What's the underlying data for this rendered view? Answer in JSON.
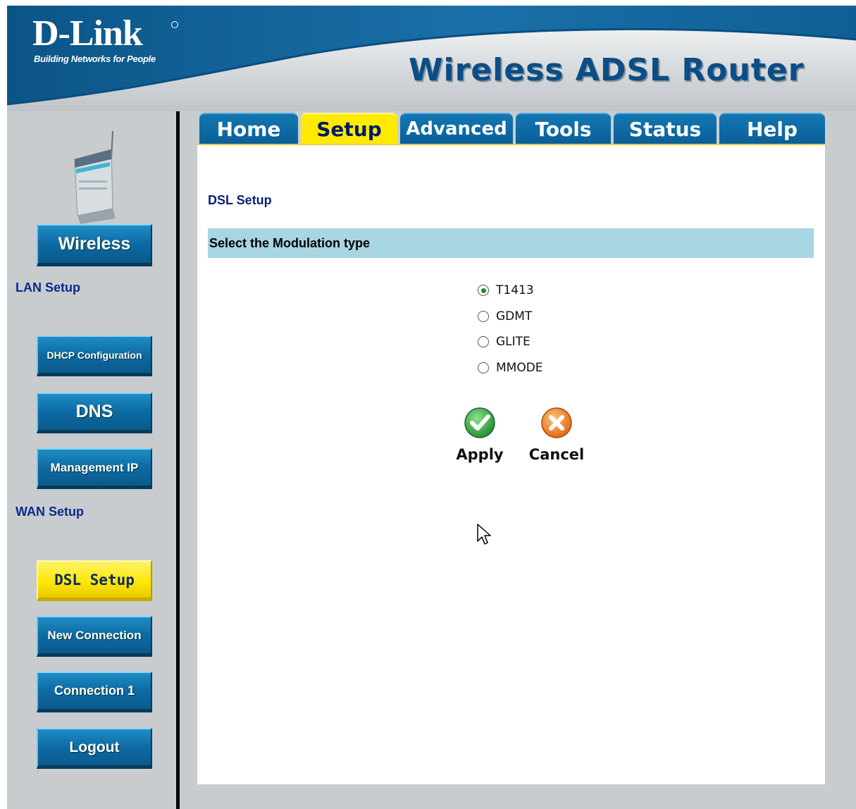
{
  "header": {
    "brand": "D-Link",
    "tagline": "Building Networks for People",
    "product_title": "Wireless ADSL Router"
  },
  "tabs": [
    {
      "label": "Home",
      "active": false
    },
    {
      "label": "Setup",
      "active": true
    },
    {
      "label": "Advanced",
      "active": false
    },
    {
      "label": "Tools",
      "active": false
    },
    {
      "label": "Status",
      "active": false
    },
    {
      "label": "Help",
      "active": false
    }
  ],
  "sidebar": {
    "wireless_button": "Wireless",
    "lan_label": "LAN Setup",
    "dhcp_button": "DHCP Configuration",
    "dns_button": "DNS",
    "management_button": "Management IP",
    "wan_label": "WAN Setup",
    "dsl_button": "DSL Setup",
    "new_connection_button": "New Connection",
    "connection1_button": "Connection 1",
    "logout_button": "Logout"
  },
  "main": {
    "section_title": "DSL Setup",
    "band_title": "Select the Modulation type",
    "modulation_options": [
      {
        "label": "T1413",
        "selected": true
      },
      {
        "label": "GDMT",
        "selected": false
      },
      {
        "label": "GLITE",
        "selected": false
      },
      {
        "label": "MMODE",
        "selected": false
      }
    ],
    "apply_label": "Apply",
    "cancel_label": "Cancel"
  },
  "colors": {
    "header_blue": "#0d5e94",
    "panel_gray": "#c9cccf",
    "active_yellow": "#ffea00",
    "band_blue": "#a8d5e2",
    "apply_green": "#2e9b3a",
    "cancel_orange": "#e8731a"
  },
  "icons": {
    "apply": "check-circle-icon",
    "cancel": "x-circle-icon"
  }
}
